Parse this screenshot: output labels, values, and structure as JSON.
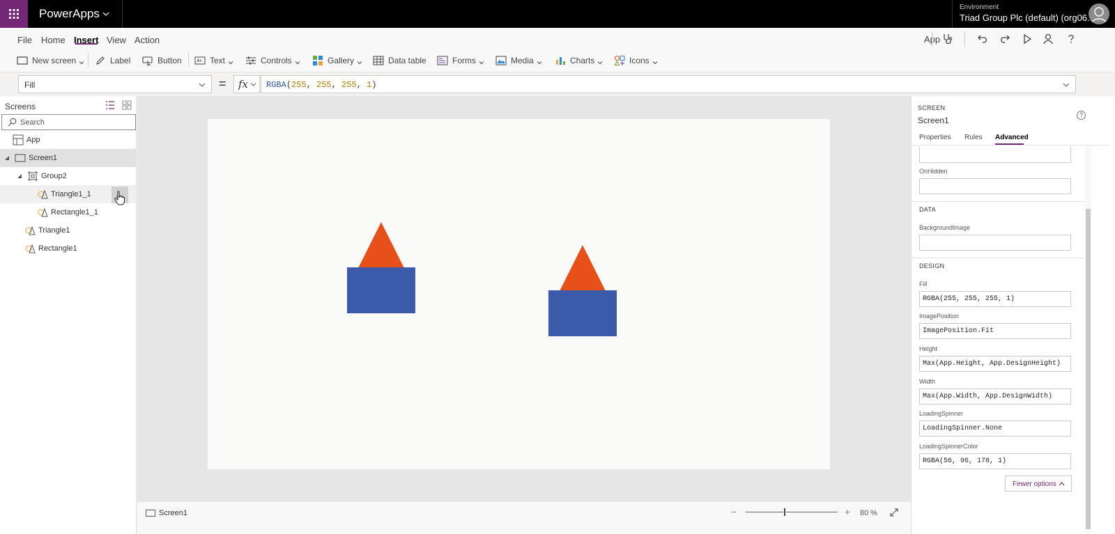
{
  "topbar": {
    "app_name": "PowerApps",
    "environment_label": "Environment",
    "environment_value": "Triad Group Plc (default) (org06..."
  },
  "menu": {
    "file": "File",
    "home": "Home",
    "insert": "Insert",
    "view": "View",
    "action": "Action",
    "app_label": "App"
  },
  "ribbon": {
    "new_screen": "New screen",
    "label": "Label",
    "button": "Button",
    "text": "Text",
    "controls": "Controls",
    "gallery": "Gallery",
    "data_table": "Data table",
    "forms": "Forms",
    "media": "Media",
    "charts": "Charts",
    "icons": "Icons"
  },
  "formula_bar": {
    "property": "Fill",
    "equals": "=",
    "fx": "fx",
    "fn": "RGBA",
    "open": "(",
    "a1": "255",
    "sep1": ", ",
    "a2": "255",
    "sep2": ", ",
    "a3": "255",
    "sep3": ", ",
    "a4": "1",
    "close": ")"
  },
  "tree": {
    "title": "Screens",
    "search_placeholder": "Search",
    "items": [
      {
        "label": "App"
      },
      {
        "label": "Screen1"
      },
      {
        "label": "Group2"
      },
      {
        "label": "Triangle1_1"
      },
      {
        "label": "Rectangle1_1"
      },
      {
        "label": "Triangle1"
      },
      {
        "label": "Rectangle1"
      }
    ],
    "more_label": "..."
  },
  "status": {
    "screen_name": "Screen1",
    "zoom_minus": "−",
    "zoom_plus": "+",
    "zoom_value": "80",
    "zoom_unit": "%"
  },
  "props": {
    "type": "SCREEN",
    "name": "Screen1",
    "help": "?",
    "tabs": [
      "Properties",
      "Rules",
      "Advanced"
    ],
    "active_tab": "Advanced",
    "on_hidden_label": "OnHidden",
    "on_hidden_value": "",
    "data_section": "DATA",
    "background_image_label": "BackgroundImage",
    "background_image_value": "",
    "design_section": "DESIGN",
    "fill_label": "Fill",
    "fill_value": "RGBA(255, 255, 255, 1)",
    "image_position_label": "ImagePosition",
    "image_position_value": "ImagePosition.Fit",
    "height_label": "Height",
    "height_value": "Max(App.Height, App.DesignHeight)",
    "width_label": "Width",
    "width_value": "Max(App.Width, App.DesignWidth)",
    "loading_spinner_label": "LoadingSpinner",
    "loading_spinner_value": "LoadingSpinner.None",
    "loading_spinner_color_label": "LoadingSpinnerColor",
    "loading_spinner_color_value": "RGBA(56, 96, 178, 1)",
    "fewer_options": "Fewer options"
  },
  "colors": {
    "brand": "#742774",
    "triangle": "#e8501a",
    "rectangle": "#3b5aaa",
    "formula_function": "#2b579a",
    "formula_number": "#b07f00"
  },
  "icons": {
    "waffle": "waffle-icon",
    "avatar": "user-avatar-icon",
    "health": "stethoscope-icon",
    "undo": "undo-icon",
    "redo": "redo-icon",
    "play": "play-icon",
    "share": "person-icon",
    "help": "help-icon"
  }
}
